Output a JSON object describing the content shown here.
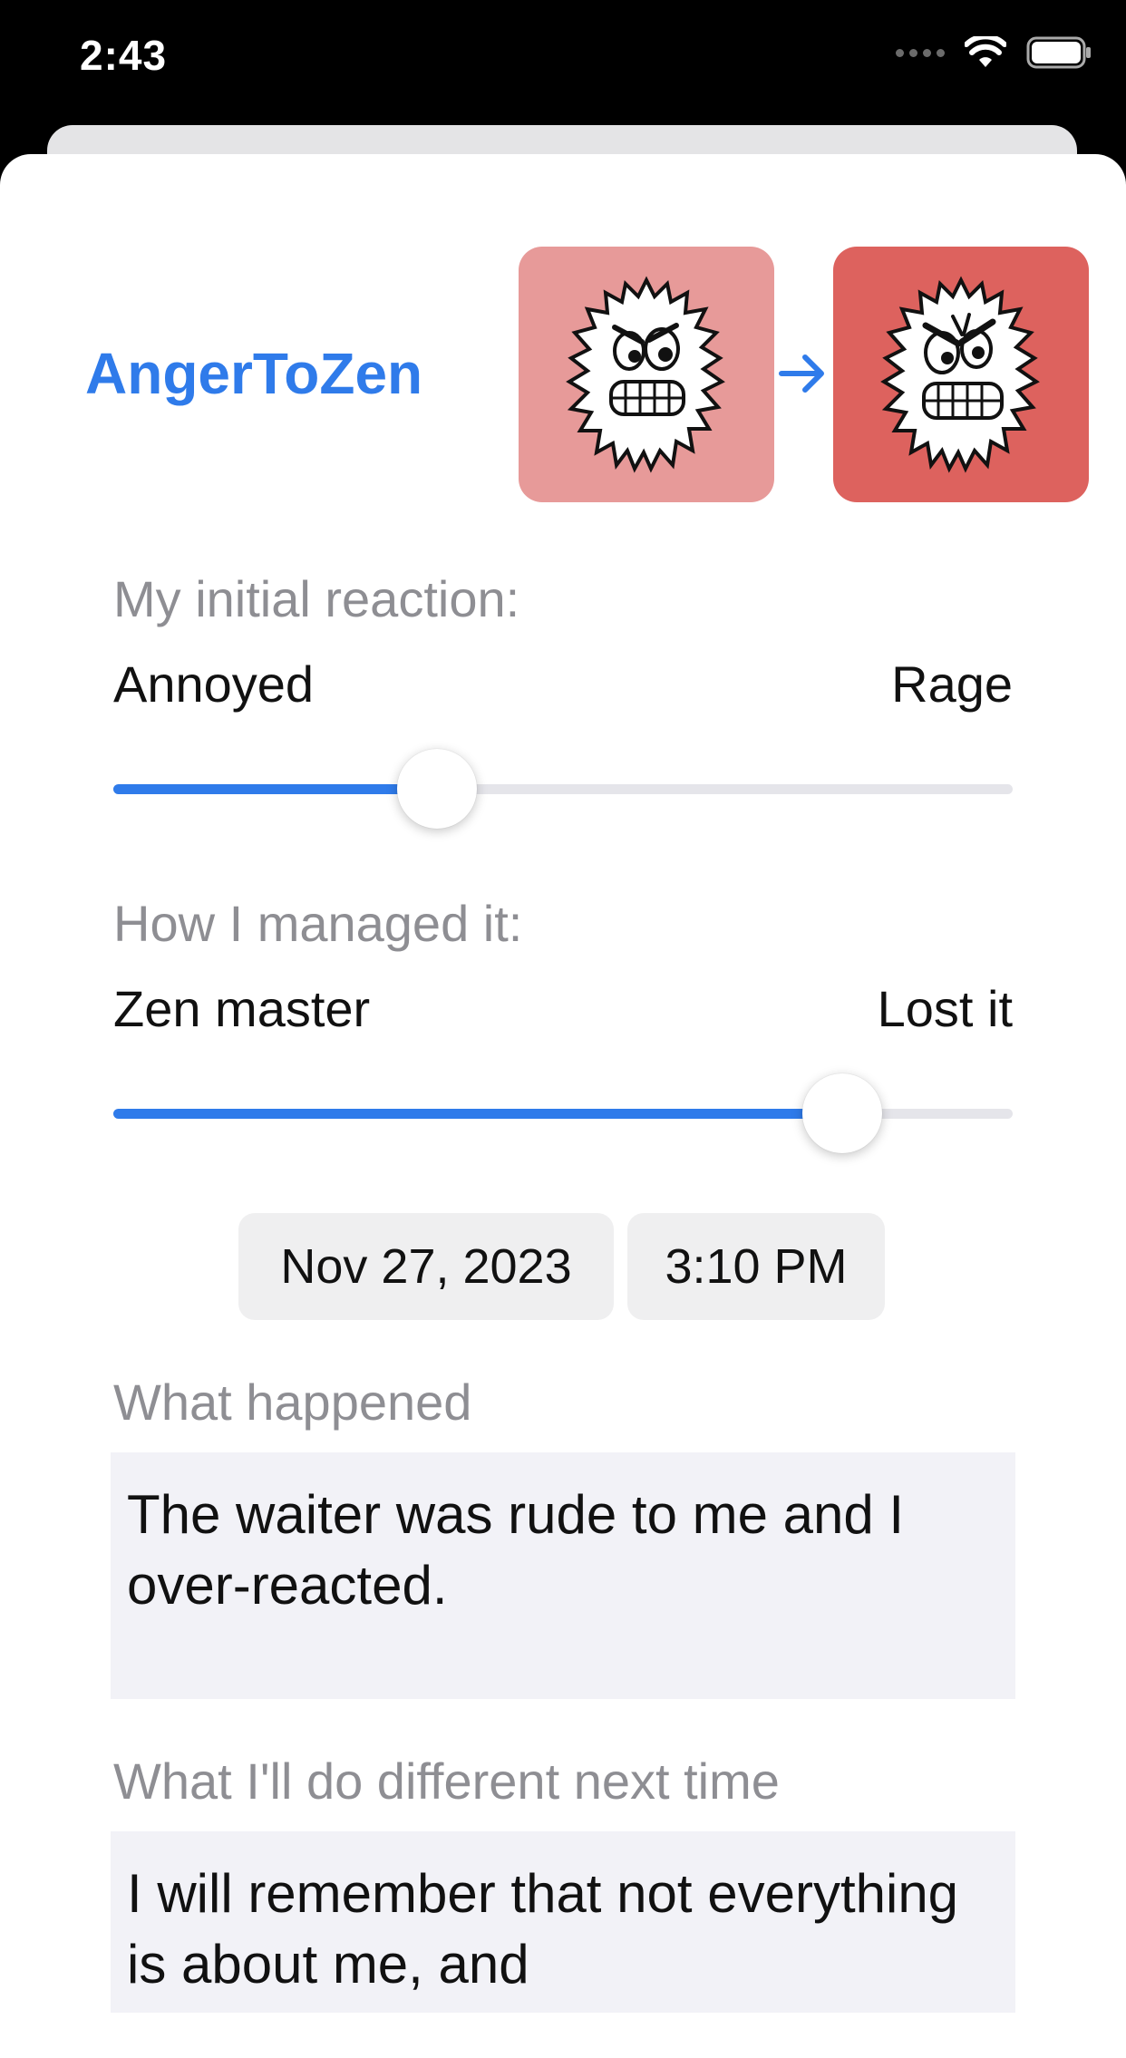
{
  "status_bar": {
    "time": "2:43"
  },
  "header": {
    "app_title": "AngerToZen",
    "arrow_icon": "arrow-right-icon"
  },
  "colors": {
    "accent": "#2f7bea",
    "initial_tile": "#e79a99",
    "managed_tile": "#dd625e",
    "muted_text": "#8e8e93",
    "field_background": "#f2f2f7"
  },
  "initial_reaction": {
    "label": "My initial reaction:",
    "min_label": "Annoyed",
    "max_label": "Rage",
    "value": 0.36
  },
  "managed": {
    "label": "How I managed it:",
    "min_label": "Zen master",
    "max_label": "Lost it",
    "value": 0.81
  },
  "datetime": {
    "date": "Nov 27, 2023",
    "time": "3:10 PM"
  },
  "what_happened": {
    "label": "What happened",
    "value": "The waiter was rude to me and I over-reacted."
  },
  "next_time": {
    "label": "What I'll do different next time",
    "value": "I will remember that not everything is about me, and"
  }
}
